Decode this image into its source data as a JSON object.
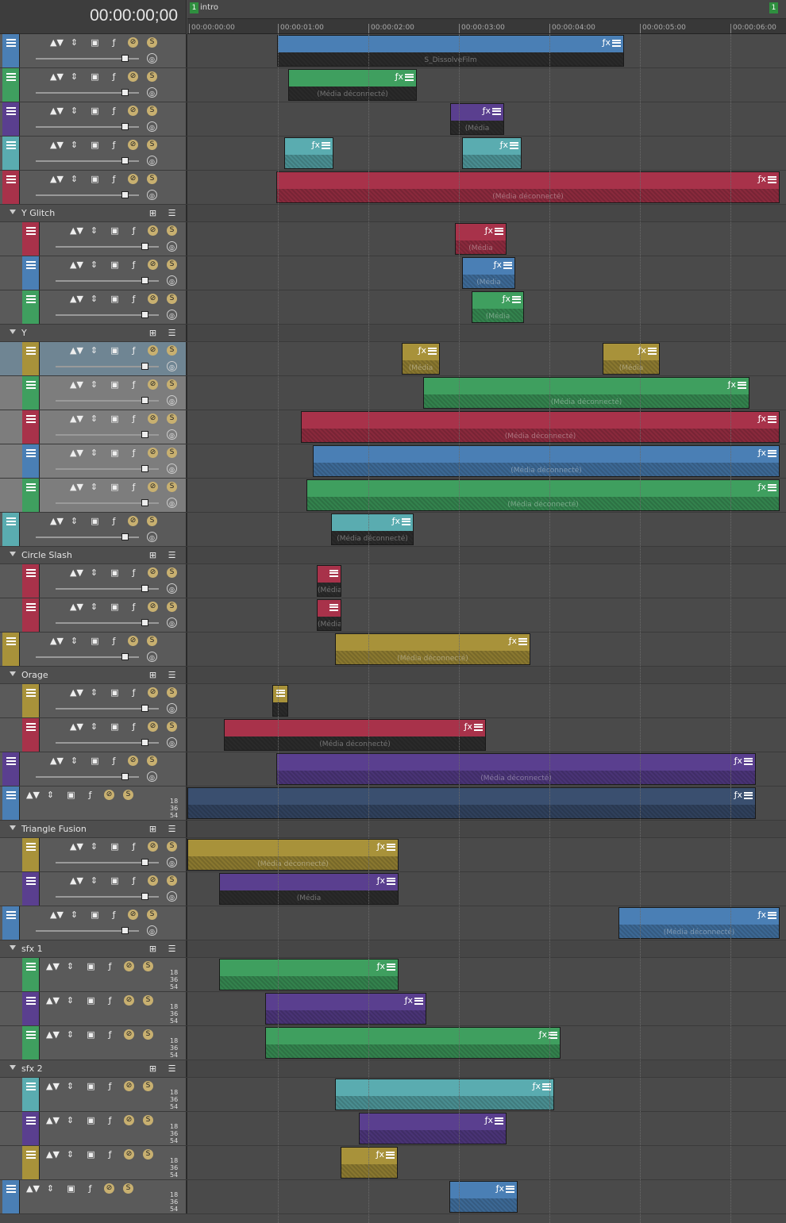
{
  "timecode": "00:00:00;00",
  "markers": [
    {
      "num": "1",
      "label": "intro"
    },
    {
      "num": "1",
      "label": ""
    }
  ],
  "ruler_ticks": [
    "00:00:00:00",
    "00:00:01:00",
    "00:00:02:00",
    "00:00:03:00",
    "00:00:04:00",
    "00:00:05:00",
    "00:00:06:00"
  ],
  "groups": {
    "y_glitch": "Y Glitch",
    "y": "Y",
    "circle_slash": "Circle Slash",
    "orage": "Orage",
    "triangle_fusion": "Triangle Fusion",
    "sfx1": "sfx 1",
    "sfx2": "sfx 2"
  },
  "clip_labels": {
    "disconnected": "(Média déconnecté)",
    "dissolve": "S_DissolveFilm",
    "short_media": "(Média",
    "deco": "déco"
  },
  "db_scale": [
    "18",
    "36",
    "54"
  ],
  "colors": {
    "blue": "#4a7fb5",
    "green": "#3f9f5f",
    "purple": "#5a3f8f",
    "teal": "#5aacb0",
    "red": "#a8324a",
    "olive": "#a8923a",
    "navy": "#3a4f6f"
  },
  "icons": [
    "menu-icon",
    "move-up-icon",
    "move-down-icon",
    "composite-icon",
    "fx-icon",
    "mute-icon",
    "solo-icon",
    "pan-crop-icon",
    "chain-icon"
  ]
}
